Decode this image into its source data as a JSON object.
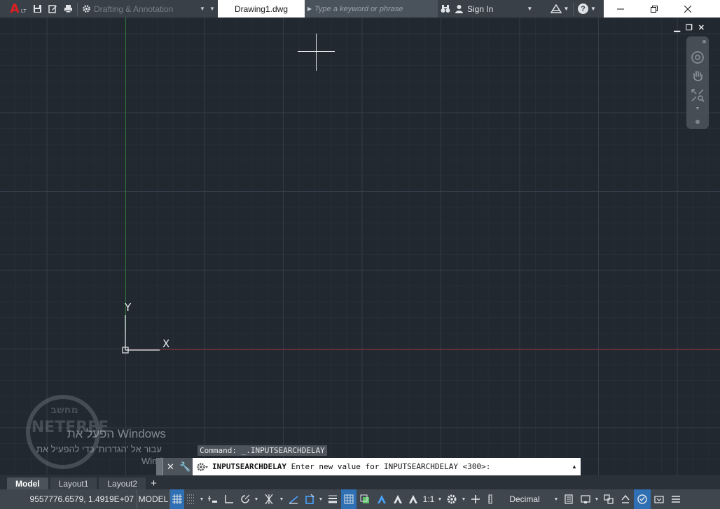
{
  "app": {
    "logo_letter": "A",
    "logo_sub": "LT",
    "workspace": "Drafting & Annotation",
    "document_tab": "Drawing1.dwg",
    "search_placeholder": "Type a keyword or phrase",
    "sign_in": "Sign In"
  },
  "canvas": {
    "ucs_y": "Y",
    "ucs_x": "X"
  },
  "watermark": {
    "brand_top": "מחשב",
    "brand_main": "NETFREE"
  },
  "activation": {
    "line1": "הפעל את Windows",
    "line2": "עבור אל 'הגדרות' כדי להפעיל את",
    "line3": "Windows"
  },
  "command": {
    "history": "Command: _.INPUTSEARCHDELAY",
    "prompt_name": "INPUTSEARCHDELAY",
    "prompt_rest": " Enter new value for INPUTSEARCHDELAY <300>:"
  },
  "tabs": {
    "model": "Model",
    "layout1": "Layout1",
    "layout2": "Layout2",
    "add": "+"
  },
  "status": {
    "coordinates": "9557776.6579, 1.4919E+07",
    "model": "MODEL",
    "scale": "1:1",
    "units": "Decimal"
  },
  "colors": {
    "canvas_bg": "#212830",
    "y_axis": "#2e7a3a",
    "x_axis": "#7a2a2e",
    "logo": "#e02020",
    "active_toggle": "#2f6fb3"
  }
}
